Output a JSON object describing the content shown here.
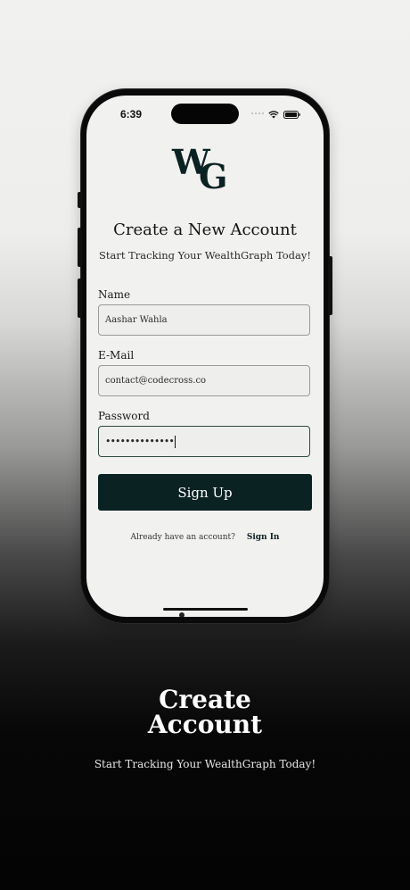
{
  "status_bar": {
    "time": "6:39"
  },
  "logo": {
    "letter_w": "W",
    "letter_g": "G"
  },
  "form": {
    "title": "Create a New Account",
    "subtitle": "Start Tracking Your WealthGraph Today!",
    "name_label": "Name",
    "name_value": "Aashar Wahla",
    "email_label": "E-Mail",
    "email_value": "contact@codecross.co",
    "password_label": "Password",
    "password_value": "••••••••••••••",
    "signup_label": "Sign Up",
    "have_account_text": "Already have an account?",
    "signin_label": "Sign In"
  },
  "caption": {
    "title_line1": "Create",
    "title_line2": "Account",
    "subtitle": "Start Tracking Your WealthGraph Today!"
  },
  "colors": {
    "brand": "#0b2223",
    "screen_bg": "#f1f1ef"
  }
}
